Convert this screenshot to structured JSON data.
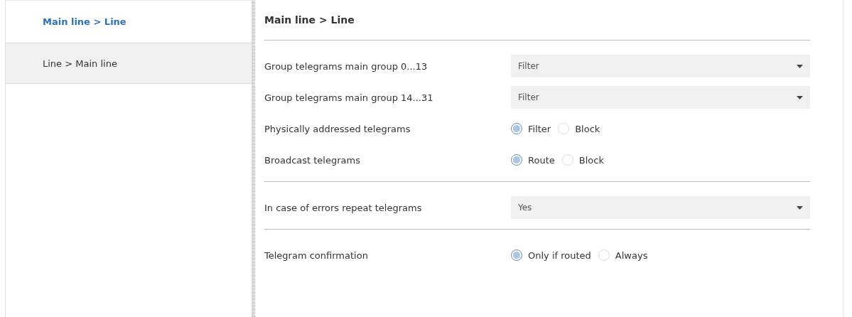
{
  "sidebar": {
    "items": [
      {
        "label": "Main line > Line",
        "selected": true
      },
      {
        "label": "Line > Main line",
        "selected": false
      }
    ]
  },
  "panel": {
    "title": "Main line > Line",
    "sections": [
      {
        "rows": [
          {
            "label": "Group telegrams main group 0...13",
            "kind": "dropdown",
            "value": "Filter"
          },
          {
            "label": "Group telegrams main group 14...31",
            "kind": "dropdown",
            "value": "Filter"
          },
          {
            "label": "Physically addressed telegrams",
            "kind": "radio",
            "options": [
              {
                "label": "Filter",
                "selected": true
              },
              {
                "label": "Block",
                "selected": false
              }
            ]
          },
          {
            "label": "Broadcast telegrams",
            "kind": "radio",
            "options": [
              {
                "label": "Route",
                "selected": true
              },
              {
                "label": "Block",
                "selected": false
              }
            ]
          }
        ]
      },
      {
        "rows": [
          {
            "label": "In case of errors repeat telegrams",
            "kind": "dropdown",
            "value": "Yes"
          }
        ]
      },
      {
        "rows": [
          {
            "label": "Telegram confirmation",
            "kind": "radio",
            "options": [
              {
                "label": "Only if routed",
                "selected": true
              },
              {
                "label": "Always",
                "selected": false
              }
            ]
          }
        ]
      }
    ]
  }
}
